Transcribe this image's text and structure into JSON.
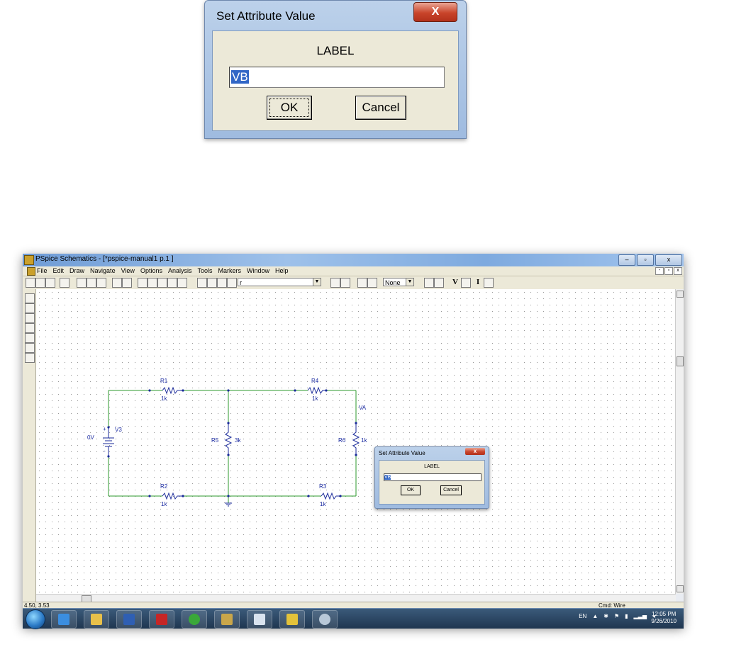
{
  "zoom_dialog": {
    "title": "Set Attribute Value",
    "close_glyph": "X",
    "label": "LABEL",
    "input_value": "VB",
    "ok_label": "OK",
    "cancel_label": "Cancel"
  },
  "window": {
    "title": "PSpice Schematics - [*pspice-manual1  p.1  ]",
    "menu": [
      "File",
      "Edit",
      "Draw",
      "Navigate",
      "View",
      "Options",
      "Analysis",
      "Tools",
      "Markers",
      "Window",
      "Help"
    ],
    "part_combo": "r",
    "none_combo": "None",
    "toolbar_v": "V",
    "toolbar_i": "I"
  },
  "circuit": {
    "components": [
      {
        "ref": "R1",
        "value": "1k"
      },
      {
        "ref": "R4",
        "value": "1k"
      },
      {
        "ref": "R5",
        "value": "3k"
      },
      {
        "ref": "R6",
        "value": "1k"
      },
      {
        "ref": "R2",
        "value": "1k"
      },
      {
        "ref": "R3",
        "value": "1k"
      },
      {
        "ref": "V3",
        "value": "0V"
      }
    ],
    "net_label": "VA",
    "polarity_plus": "+",
    "polarity_minus": "-"
  },
  "small_dialog": {
    "title": "Set Attribute Value",
    "label": "LABEL",
    "input_value": "VB",
    "ok_label": "OK",
    "cancel_label": "Cancel"
  },
  "status": {
    "coords": "4.50,  3.53",
    "cmd": "Cmd: Wire"
  },
  "taskbar": {
    "language": "EN",
    "time": "12:05 PM",
    "date": "9/26/2010"
  },
  "colors": {
    "wire": "#2e9a2e",
    "component": "#1a2a9a",
    "label": "#1a2aa0",
    "selection": "#3166c6"
  }
}
